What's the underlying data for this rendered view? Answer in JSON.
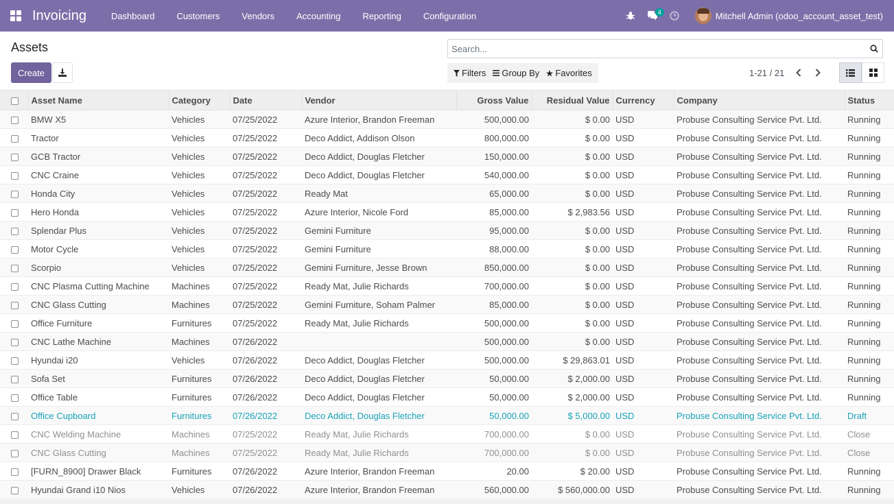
{
  "navbar": {
    "app_title": "Invoicing",
    "menu": [
      "Dashboard",
      "Customers",
      "Vendors",
      "Accounting",
      "Reporting",
      "Configuration"
    ],
    "messages_count": "4",
    "user_name": "Mitchell Admin (odoo_account_asset_test)",
    "icons": [
      "apps-grid-icon",
      "bug-icon",
      "chat-bubbles-icon",
      "clock-icon"
    ],
    "color": "#7c6fa9"
  },
  "control_panel": {
    "breadcrumb": "Assets",
    "create_label": "Create",
    "search_placeholder": "Search...",
    "filters_label": "Filters",
    "group_by_label": "Group By",
    "favorites_label": "Favorites",
    "pager_text": "1-21 / 21",
    "active_view": "list"
  },
  "table": {
    "columns": [
      "Asset Name",
      "Category",
      "Date",
      "Vendor",
      "Gross Value",
      "Residual Value",
      "Currency",
      "Company",
      "Status"
    ],
    "rows": [
      {
        "name": "BMW X5",
        "category": "Vehicles",
        "date": "07/25/2022",
        "vendor": "Azure Interior, Brandon Freeman",
        "gross": "500,000.00",
        "residual": "$ 0.00",
        "currency": "USD",
        "company": "Probuse Consulting Service Pvt. Ltd.",
        "status": "Running",
        "state": "running"
      },
      {
        "name": "Tractor",
        "category": "Vehicles",
        "date": "07/25/2022",
        "vendor": "Deco Addict, Addison Olson",
        "gross": "800,000.00",
        "residual": "$ 0.00",
        "currency": "USD",
        "company": "Probuse Consulting Service Pvt. Ltd.",
        "status": "Running",
        "state": "running"
      },
      {
        "name": "GCB Tractor",
        "category": "Vehicles",
        "date": "07/25/2022",
        "vendor": "Deco Addict, Douglas Fletcher",
        "gross": "150,000.00",
        "residual": "$ 0.00",
        "currency": "USD",
        "company": "Probuse Consulting Service Pvt. Ltd.",
        "status": "Running",
        "state": "running"
      },
      {
        "name": "CNC Craine",
        "category": "Vehicles",
        "date": "07/25/2022",
        "vendor": "Deco Addict, Douglas Fletcher",
        "gross": "540,000.00",
        "residual": "$ 0.00",
        "currency": "USD",
        "company": "Probuse Consulting Service Pvt. Ltd.",
        "status": "Running",
        "state": "running"
      },
      {
        "name": "Honda City",
        "category": "Vehicles",
        "date": "07/25/2022",
        "vendor": "Ready Mat",
        "gross": "65,000.00",
        "residual": "$ 0.00",
        "currency": "USD",
        "company": "Probuse Consulting Service Pvt. Ltd.",
        "status": "Running",
        "state": "running"
      },
      {
        "name": "Hero Honda",
        "category": "Vehicles",
        "date": "07/25/2022",
        "vendor": "Azure Interior, Nicole Ford",
        "gross": "85,000.00",
        "residual": "$ 2,983.56",
        "currency": "USD",
        "company": "Probuse Consulting Service Pvt. Ltd.",
        "status": "Running",
        "state": "running"
      },
      {
        "name": "Splendar Plus",
        "category": "Vehicles",
        "date": "07/25/2022",
        "vendor": "Gemini Furniture",
        "gross": "95,000.00",
        "residual": "$ 0.00",
        "currency": "USD",
        "company": "Probuse Consulting Service Pvt. Ltd.",
        "status": "Running",
        "state": "running"
      },
      {
        "name": "Motor Cycle",
        "category": "Vehicles",
        "date": "07/25/2022",
        "vendor": "Gemini Furniture",
        "gross": "88,000.00",
        "residual": "$ 0.00",
        "currency": "USD",
        "company": "Probuse Consulting Service Pvt. Ltd.",
        "status": "Running",
        "state": "running"
      },
      {
        "name": "Scorpio",
        "category": "Vehicles",
        "date": "07/25/2022",
        "vendor": "Gemini Furniture, Jesse Brown",
        "gross": "850,000.00",
        "residual": "$ 0.00",
        "currency": "USD",
        "company": "Probuse Consulting Service Pvt. Ltd.",
        "status": "Running",
        "state": "running"
      },
      {
        "name": "CNC Plasma Cutting Machine",
        "category": "Machines",
        "date": "07/25/2022",
        "vendor": "Ready Mat, Julie Richards",
        "gross": "700,000.00",
        "residual": "$ 0.00",
        "currency": "USD",
        "company": "Probuse Consulting Service Pvt. Ltd.",
        "status": "Running",
        "state": "running"
      },
      {
        "name": "CNC Glass Cutting",
        "category": "Machines",
        "date": "07/25/2022",
        "vendor": "Gemini Furniture, Soham Palmer",
        "gross": "85,000.00",
        "residual": "$ 0.00",
        "currency": "USD",
        "company": "Probuse Consulting Service Pvt. Ltd.",
        "status": "Running",
        "state": "running"
      },
      {
        "name": "Office Furniture",
        "category": "Furnitures",
        "date": "07/25/2022",
        "vendor": "Ready Mat, Julie Richards",
        "gross": "500,000.00",
        "residual": "$ 0.00",
        "currency": "USD",
        "company": "Probuse Consulting Service Pvt. Ltd.",
        "status": "Running",
        "state": "running"
      },
      {
        "name": "CNC Lathe Machine",
        "category": "Machines",
        "date": "07/26/2022",
        "vendor": "",
        "gross": "500,000.00",
        "residual": "$ 0.00",
        "currency": "USD",
        "company": "Probuse Consulting Service Pvt. Ltd.",
        "status": "Running",
        "state": "running"
      },
      {
        "name": "Hyundai i20",
        "category": "Vehicles",
        "date": "07/26/2022",
        "vendor": "Deco Addict, Douglas Fletcher",
        "gross": "500,000.00",
        "residual": "$ 29,863.01",
        "currency": "USD",
        "company": "Probuse Consulting Service Pvt. Ltd.",
        "status": "Running",
        "state": "running"
      },
      {
        "name": "Sofa Set",
        "category": "Furnitures",
        "date": "07/26/2022",
        "vendor": "Deco Addict, Douglas Fletcher",
        "gross": "50,000.00",
        "residual": "$ 2,000.00",
        "currency": "USD",
        "company": "Probuse Consulting Service Pvt. Ltd.",
        "status": "Running",
        "state": "running"
      },
      {
        "name": "Office Table",
        "category": "Furnitures",
        "date": "07/26/2022",
        "vendor": "Deco Addict, Douglas Fletcher",
        "gross": "50,000.00",
        "residual": "$ 2,000.00",
        "currency": "USD",
        "company": "Probuse Consulting Service Pvt. Ltd.",
        "status": "Running",
        "state": "running"
      },
      {
        "name": "Office Cupboard",
        "category": "Furnitures",
        "date": "07/26/2022",
        "vendor": "Deco Addict, Douglas Fletcher",
        "gross": "50,000.00",
        "residual": "$ 5,000.00",
        "currency": "USD",
        "company": "Probuse Consulting Service Pvt. Ltd.",
        "status": "Draft",
        "state": "draft"
      },
      {
        "name": "CNC Welding Machine",
        "category": "Machines",
        "date": "07/25/2022",
        "vendor": "Ready Mat, Julie Richards",
        "gross": "700,000.00",
        "residual": "$ 0.00",
        "currency": "USD",
        "company": "Probuse Consulting Service Pvt. Ltd.",
        "status": "Close",
        "state": "close"
      },
      {
        "name": "CNC Glass Cutting",
        "category": "Machines",
        "date": "07/25/2022",
        "vendor": "Ready Mat, Julie Richards",
        "gross": "700,000.00",
        "residual": "$ 0.00",
        "currency": "USD",
        "company": "Probuse Consulting Service Pvt. Ltd.",
        "status": "Close",
        "state": "close"
      },
      {
        "name": "[FURN_8900] Drawer Black",
        "category": "Furnitures",
        "date": "07/26/2022",
        "vendor": "Azure Interior, Brandon Freeman",
        "gross": "20.00",
        "residual": "$ 20.00",
        "currency": "USD",
        "company": "Probuse Consulting Service Pvt. Ltd.",
        "status": "Running",
        "state": "running"
      },
      {
        "name": "Hyundai Grand i10 Nios",
        "category": "Vehicles",
        "date": "07/26/2022",
        "vendor": "Azure Interior, Brandon Freeman",
        "gross": "560,000.00",
        "residual": "$ 560,000.00",
        "currency": "USD",
        "company": "Probuse Consulting Service Pvt. Ltd.",
        "status": "Running",
        "state": "running"
      }
    ]
  }
}
